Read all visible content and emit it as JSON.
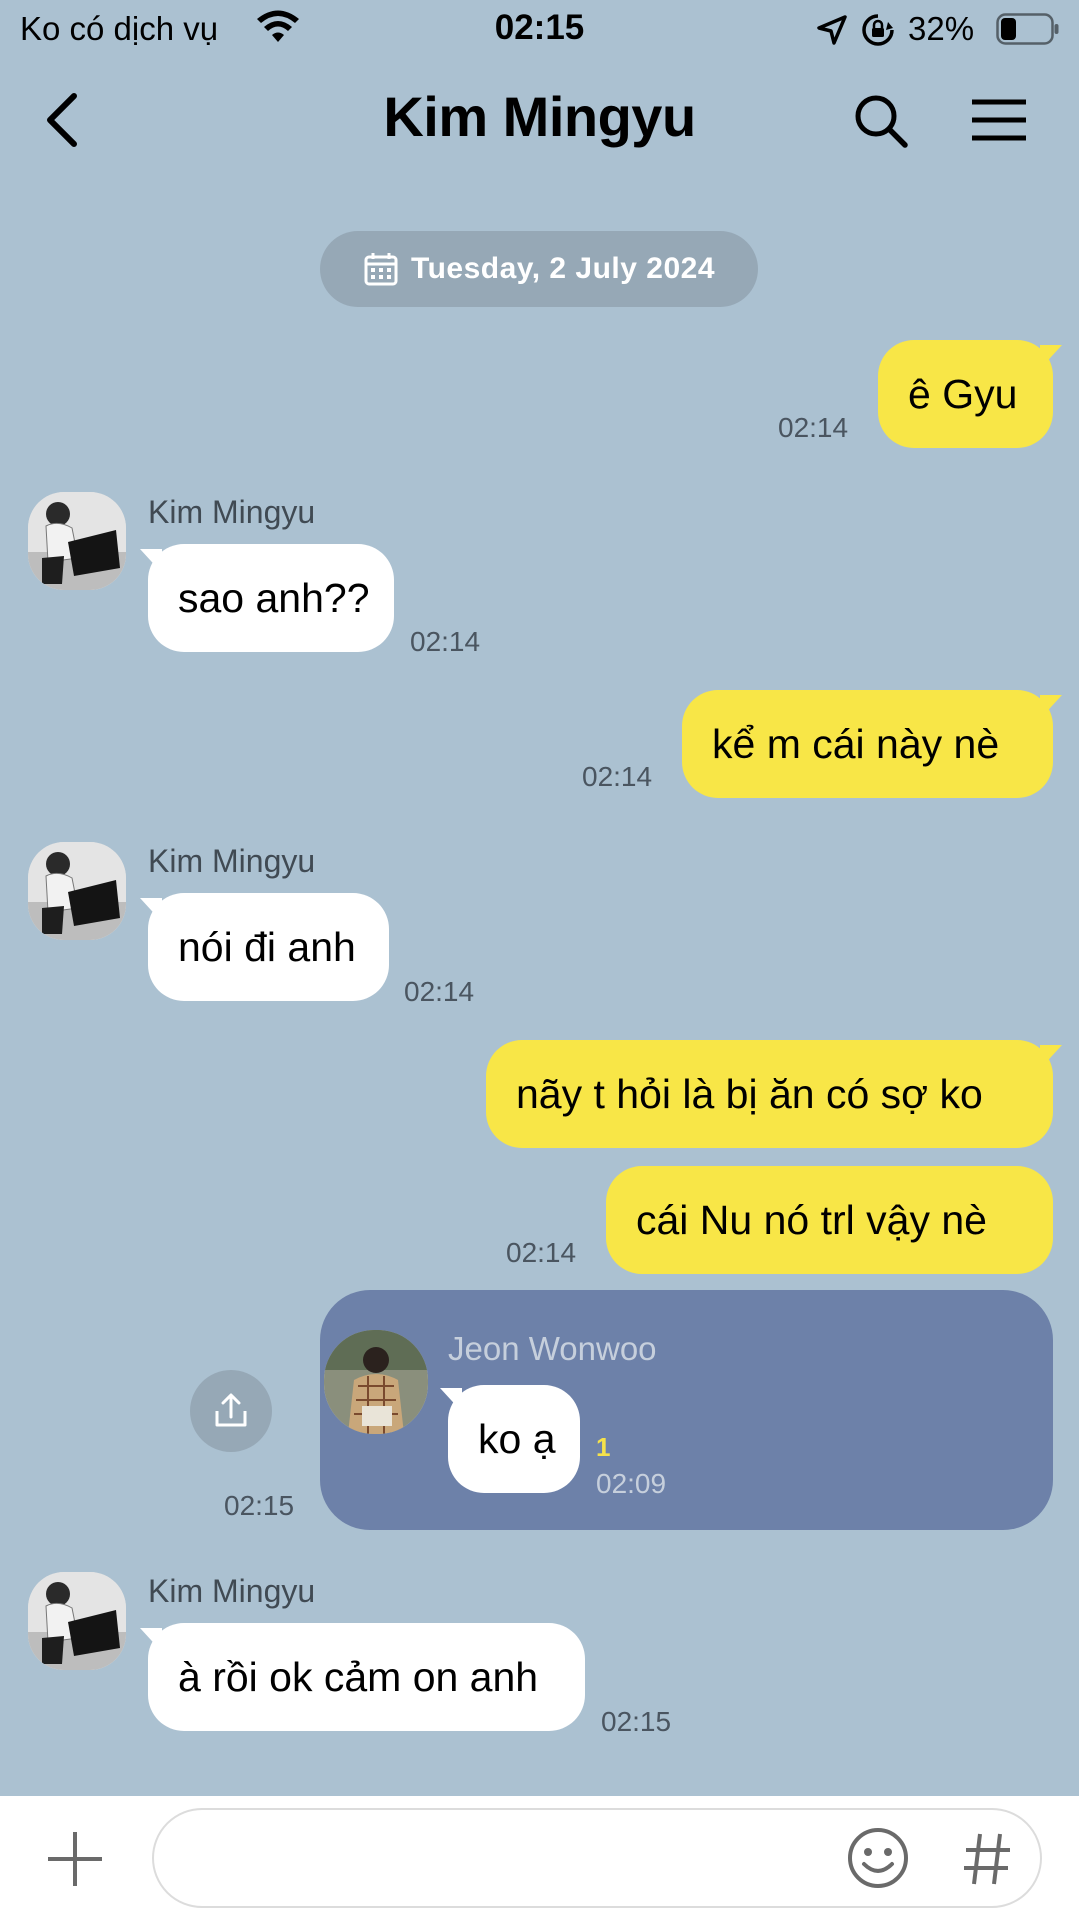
{
  "status_bar": {
    "carrier": "Ko có dịch vụ",
    "time": "02:15",
    "battery": "32%"
  },
  "header": {
    "title": "Kim Mingyu"
  },
  "date_separator": "Tuesday, 2 July 2024",
  "messages": [
    {
      "from": "me",
      "text": "ê Gyu",
      "time": "02:14"
    },
    {
      "from": "them",
      "sender": "Kim Mingyu",
      "text": "sao anh??",
      "time": "02:14"
    },
    {
      "from": "me",
      "text": "kể m cái này nè",
      "time": "02:14"
    },
    {
      "from": "them",
      "sender": "Kim Mingyu",
      "text": "nói đi anh",
      "time": "02:14"
    },
    {
      "from": "me",
      "text": "nãy t hỏi là bị ăn có sợ ko",
      "time": ""
    },
    {
      "from": "me",
      "text": "cái Nu nó trl vậy nè",
      "time": "02:14"
    },
    {
      "from": "them",
      "sender": "Kim Mingyu",
      "text": "à rồi ok cảm on anh",
      "time": "02:15"
    }
  ],
  "forwarded": {
    "sender": "Jeon Wonwoo",
    "text": "ko ạ",
    "unread": "1",
    "inner_time": "02:09",
    "time": "02:15"
  },
  "icons": {
    "wifi": "wifi-icon",
    "location": "location-arrow-icon",
    "rotation_lock": "rotation-lock-icon",
    "battery": "battery-icon",
    "back": "chevron-left-icon",
    "search": "search-icon",
    "menu": "hamburger-menu-icon",
    "calendar": "calendar-icon",
    "share": "share-icon",
    "plus": "plus-icon",
    "emoji": "emoji-icon",
    "hash": "hash-icon"
  },
  "colors": {
    "background": "#abc1d1",
    "my_bubble": "#f8e647",
    "their_bubble": "#ffffff",
    "forward_card": "#6d81a9"
  }
}
